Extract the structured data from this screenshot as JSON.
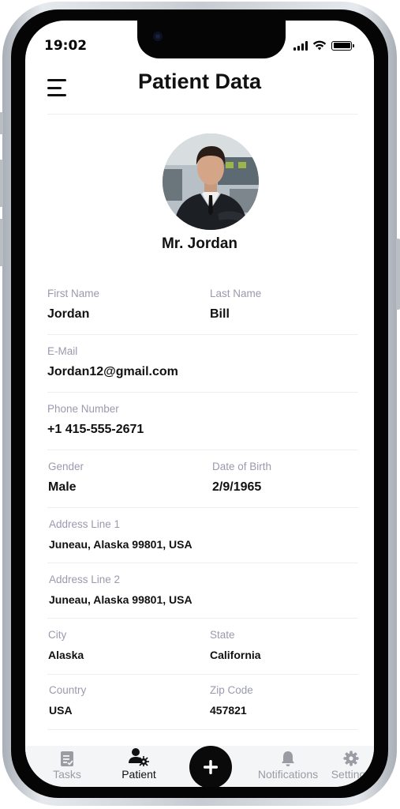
{
  "status_bar": {
    "time": "19:02"
  },
  "header": {
    "title": "Patient Data"
  },
  "profile": {
    "name": "Mr. Jordan"
  },
  "fields": {
    "first_name": {
      "label": "First Name",
      "value": "Jordan"
    },
    "last_name": {
      "label": "Last Name",
      "value": "Bill"
    },
    "email": {
      "label": "E-Mail",
      "value": "Jordan12@gmail.com"
    },
    "phone": {
      "label": "Phone Number",
      "value": "+1 415-555-2671"
    },
    "gender": {
      "label": "Gender",
      "value": "Male"
    },
    "dob": {
      "label": "Date of Birth",
      "value": "2/9/1965"
    },
    "address1": {
      "label": "Address Line 1",
      "value": "Juneau, Alaska 99801, USA"
    },
    "address2": {
      "label": "Address Line 2",
      "value": "Juneau, Alaska 99801, USA"
    },
    "city": {
      "label": "City",
      "value": "Alaska"
    },
    "state": {
      "label": "State",
      "value": "California"
    },
    "country": {
      "label": "Country",
      "value": "USA"
    },
    "zip": {
      "label": "Zip Code",
      "value": "457821"
    }
  },
  "tabbar": {
    "tasks": {
      "label": "Tasks",
      "icon": "clipboard-icon"
    },
    "patient": {
      "label": "Patient",
      "icon": "patient-icon"
    },
    "add": {
      "icon": "plus-icon"
    },
    "notifications": {
      "label": "Notifications",
      "icon": "bell-icon"
    },
    "settings": {
      "label": "Settings",
      "icon": "gear-icon"
    }
  },
  "colors": {
    "label": "#9a9aae",
    "inactive_tab": "#9a9ca4",
    "fab": "#0a0a0a"
  }
}
